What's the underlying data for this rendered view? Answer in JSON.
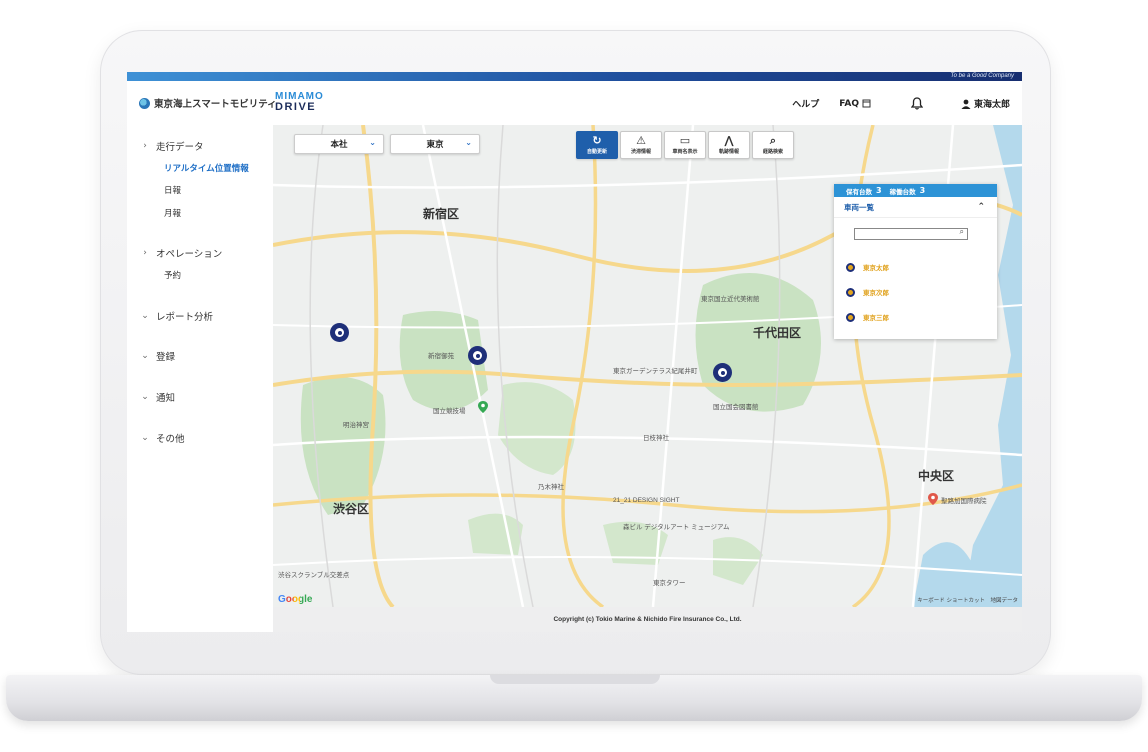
{
  "header": {
    "tagline": "To be a Good Company",
    "brand_name": "東京海上スマートモビリティ",
    "app_logo_line1": "MIMAMO",
    "app_logo_line2": "DRIVE",
    "help_label": "ヘルプ",
    "faq_label": "FAQ",
    "user_name": "東海太郎"
  },
  "sidebar": {
    "groups": [
      {
        "label": "走行データ",
        "expanded": true,
        "items": [
          "リアルタイム位置情報",
          "日報",
          "月報"
        ],
        "active_item": "リアルタイム位置情報"
      },
      {
        "label": "オペレーション",
        "expanded": true,
        "items": [
          "予約"
        ]
      },
      {
        "label": "レポート分析",
        "expanded": false
      },
      {
        "label": "登録",
        "expanded": false
      },
      {
        "label": "通知",
        "expanded": false
      },
      {
        "label": "その他",
        "expanded": false
      }
    ]
  },
  "map": {
    "filters": {
      "office": "本社",
      "region": "東京"
    },
    "tools": [
      {
        "label": "自動更新",
        "icon": "refresh-icon",
        "active": true
      },
      {
        "label": "渋滞情報",
        "icon": "warning-icon",
        "active": false
      },
      {
        "label": "車両名表示",
        "icon": "speech-bubble-icon",
        "active": false
      },
      {
        "label": "軌跡情報",
        "icon": "road-icon",
        "active": false
      },
      {
        "label": "経路検索",
        "icon": "search-icon",
        "active": false
      }
    ],
    "area_labels": [
      "新宿区",
      "千代田区",
      "渋谷区",
      "中央区"
    ],
    "place_labels": [
      "東京国立近代美術館",
      "東京ガーデンテラス紀尾井町",
      "国立国会図書館",
      "明治神宮",
      "新宿御苑",
      "21_21 DESIGN SIGHT",
      "森ビル デジタルアート ミュージアム",
      "聖路加国際病院",
      "東京タワー",
      "渋谷スクランブル交差点",
      "国立競技場",
      "日枝神社",
      "乃木神社"
    ],
    "google_label": "Google",
    "legal": "キーボード ショートカット　地図データ",
    "vehicle_markers": 3
  },
  "vehicle_panel": {
    "owned_label": "保有台数",
    "owned_count": "3",
    "active_label": "稼働台数",
    "active_count": "3",
    "list_title": "車両一覧",
    "vehicles": [
      "東京太郎",
      "東京次郎",
      "東京三郎"
    ]
  },
  "footer": {
    "copyright": "Copyright (c) Tokio Marine & Nichido Fire Insurance Co., Ltd."
  },
  "colors": {
    "brand_blue": "#1f6fc6",
    "marker_navy": "#1e2f79",
    "panel_blue": "#2d93d6",
    "vehicle_gold": "#e0a11b"
  }
}
